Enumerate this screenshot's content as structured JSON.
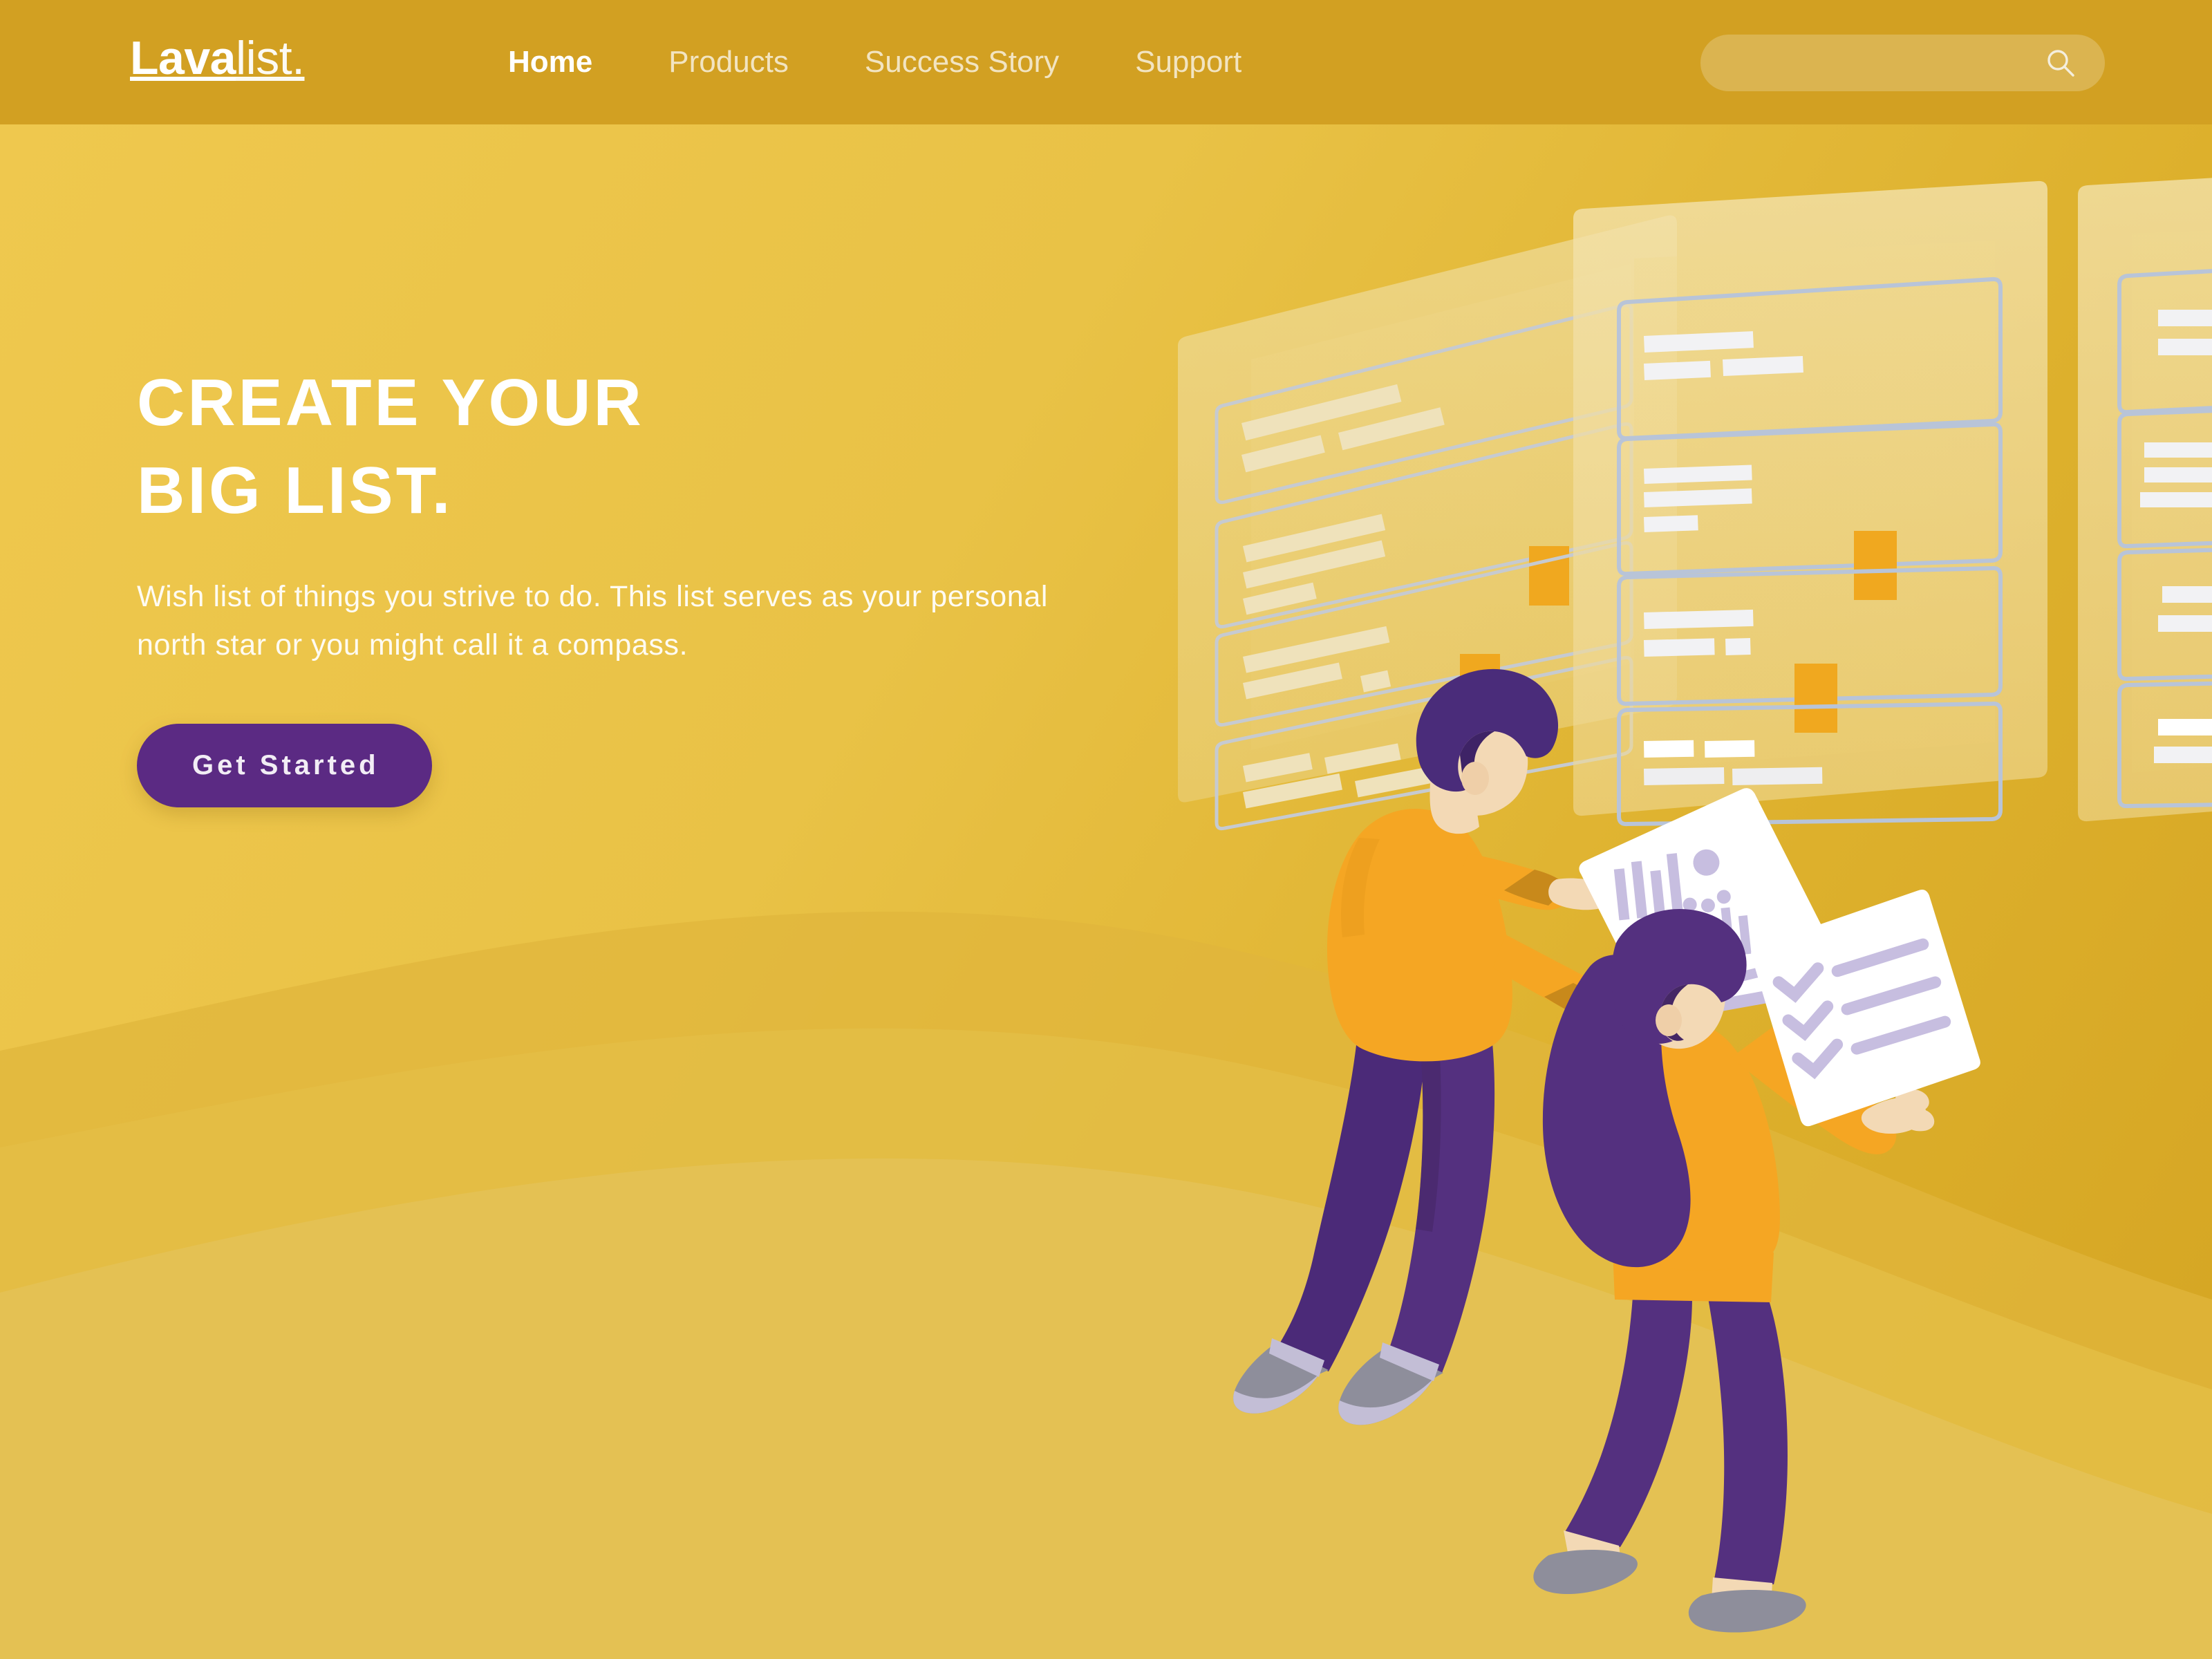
{
  "brand": {
    "logo_strong": "Lava",
    "logo_light": "list.",
    "accent_purple": "#5B2A83",
    "accent_orange": "#F5A623",
    "header_bg": "#D2A022",
    "hero_bg_top": "#EFC84E",
    "hero_bg_bottom": "#D4A422"
  },
  "header": {
    "nav": [
      {
        "label": "Home",
        "active": true
      },
      {
        "label": "Products",
        "active": false
      },
      {
        "label": "Success Story",
        "active": false
      },
      {
        "label": "Support",
        "active": false
      }
    ],
    "search": {
      "value": "",
      "placeholder": "",
      "icon": "search-icon"
    }
  },
  "hero": {
    "headline_line1": "Create Your",
    "headline_line2": "Big List.",
    "subcopy": "Wish list of things you strive to do. This list serves as your personal north star or you might call it a compass.",
    "cta_label": "Get Started"
  },
  "illustration": {
    "description": "Two people in front of three translucent task boards",
    "boards": [
      {
        "name": "board-far-left",
        "cards": 4,
        "bar_color": "#EFE2BB",
        "outline_color": "#C3C7CC",
        "orange_tiles": 2
      },
      {
        "name": "board-center",
        "cards": 4,
        "bar_color": "#FFFFFF",
        "outline_color": "#B8C4D8",
        "orange_tiles": 2
      },
      {
        "name": "board-right-cropped",
        "cards": 4,
        "bar_color": "#FFFFFF",
        "outline_color": "#B8C4D8",
        "orange_tiles": 0
      }
    ],
    "characters": [
      {
        "name": "man-with-chart-paper",
        "hair": "#4A2C7A",
        "top": "#F5A623",
        "pants": "#54307F",
        "shoes": "#8E8E9B",
        "skin": "#F3D9B5",
        "holds": "chart-document"
      },
      {
        "name": "woman-with-checklist",
        "hair": "#54307F",
        "top": "#F5A623",
        "pants": "#54307F",
        "shoes": "#8E8E9B",
        "skin": "#F3D9B5",
        "holds": "checklist-document",
        "checklist_items": 3
      }
    ]
  }
}
